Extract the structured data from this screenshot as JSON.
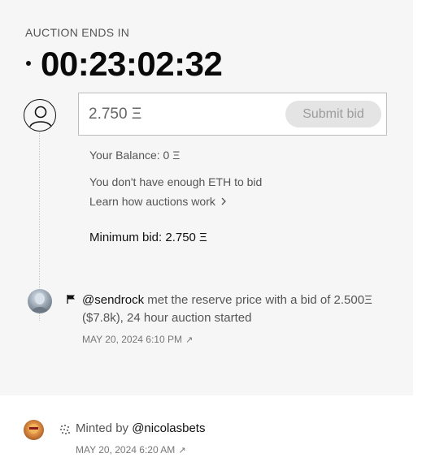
{
  "auction": {
    "ends_label": "AUCTION ENDS IN",
    "countdown": "00:23:02:32"
  },
  "bid_form": {
    "placeholder": "2.750 Ξ",
    "submit_label": "Submit bid",
    "balance_text": "Your Balance: 0 Ξ",
    "warning_text": "You don't have enough ETH to bid",
    "learn_link": "Learn how auctions work",
    "minimum_bid": "Minimum bid: 2.750 Ξ"
  },
  "activity": [
    {
      "handle": "@sendrock",
      "text": " met the reserve price with a bid of 2.500Ξ ($7.8k), 24 hour auction started",
      "date": "MAY 20, 2024 6:10 PM",
      "icon": "flag-icon"
    },
    {
      "prefix": "Minted by ",
      "handle": "@nicolasbets",
      "date": "MAY 20, 2024 6:20 AM",
      "icon": "sparkle-icon"
    }
  ],
  "colors": {
    "panel_bg": "#f6f6f6",
    "button_bg": "#e4e4e4",
    "button_text": "#9c9c9c"
  }
}
